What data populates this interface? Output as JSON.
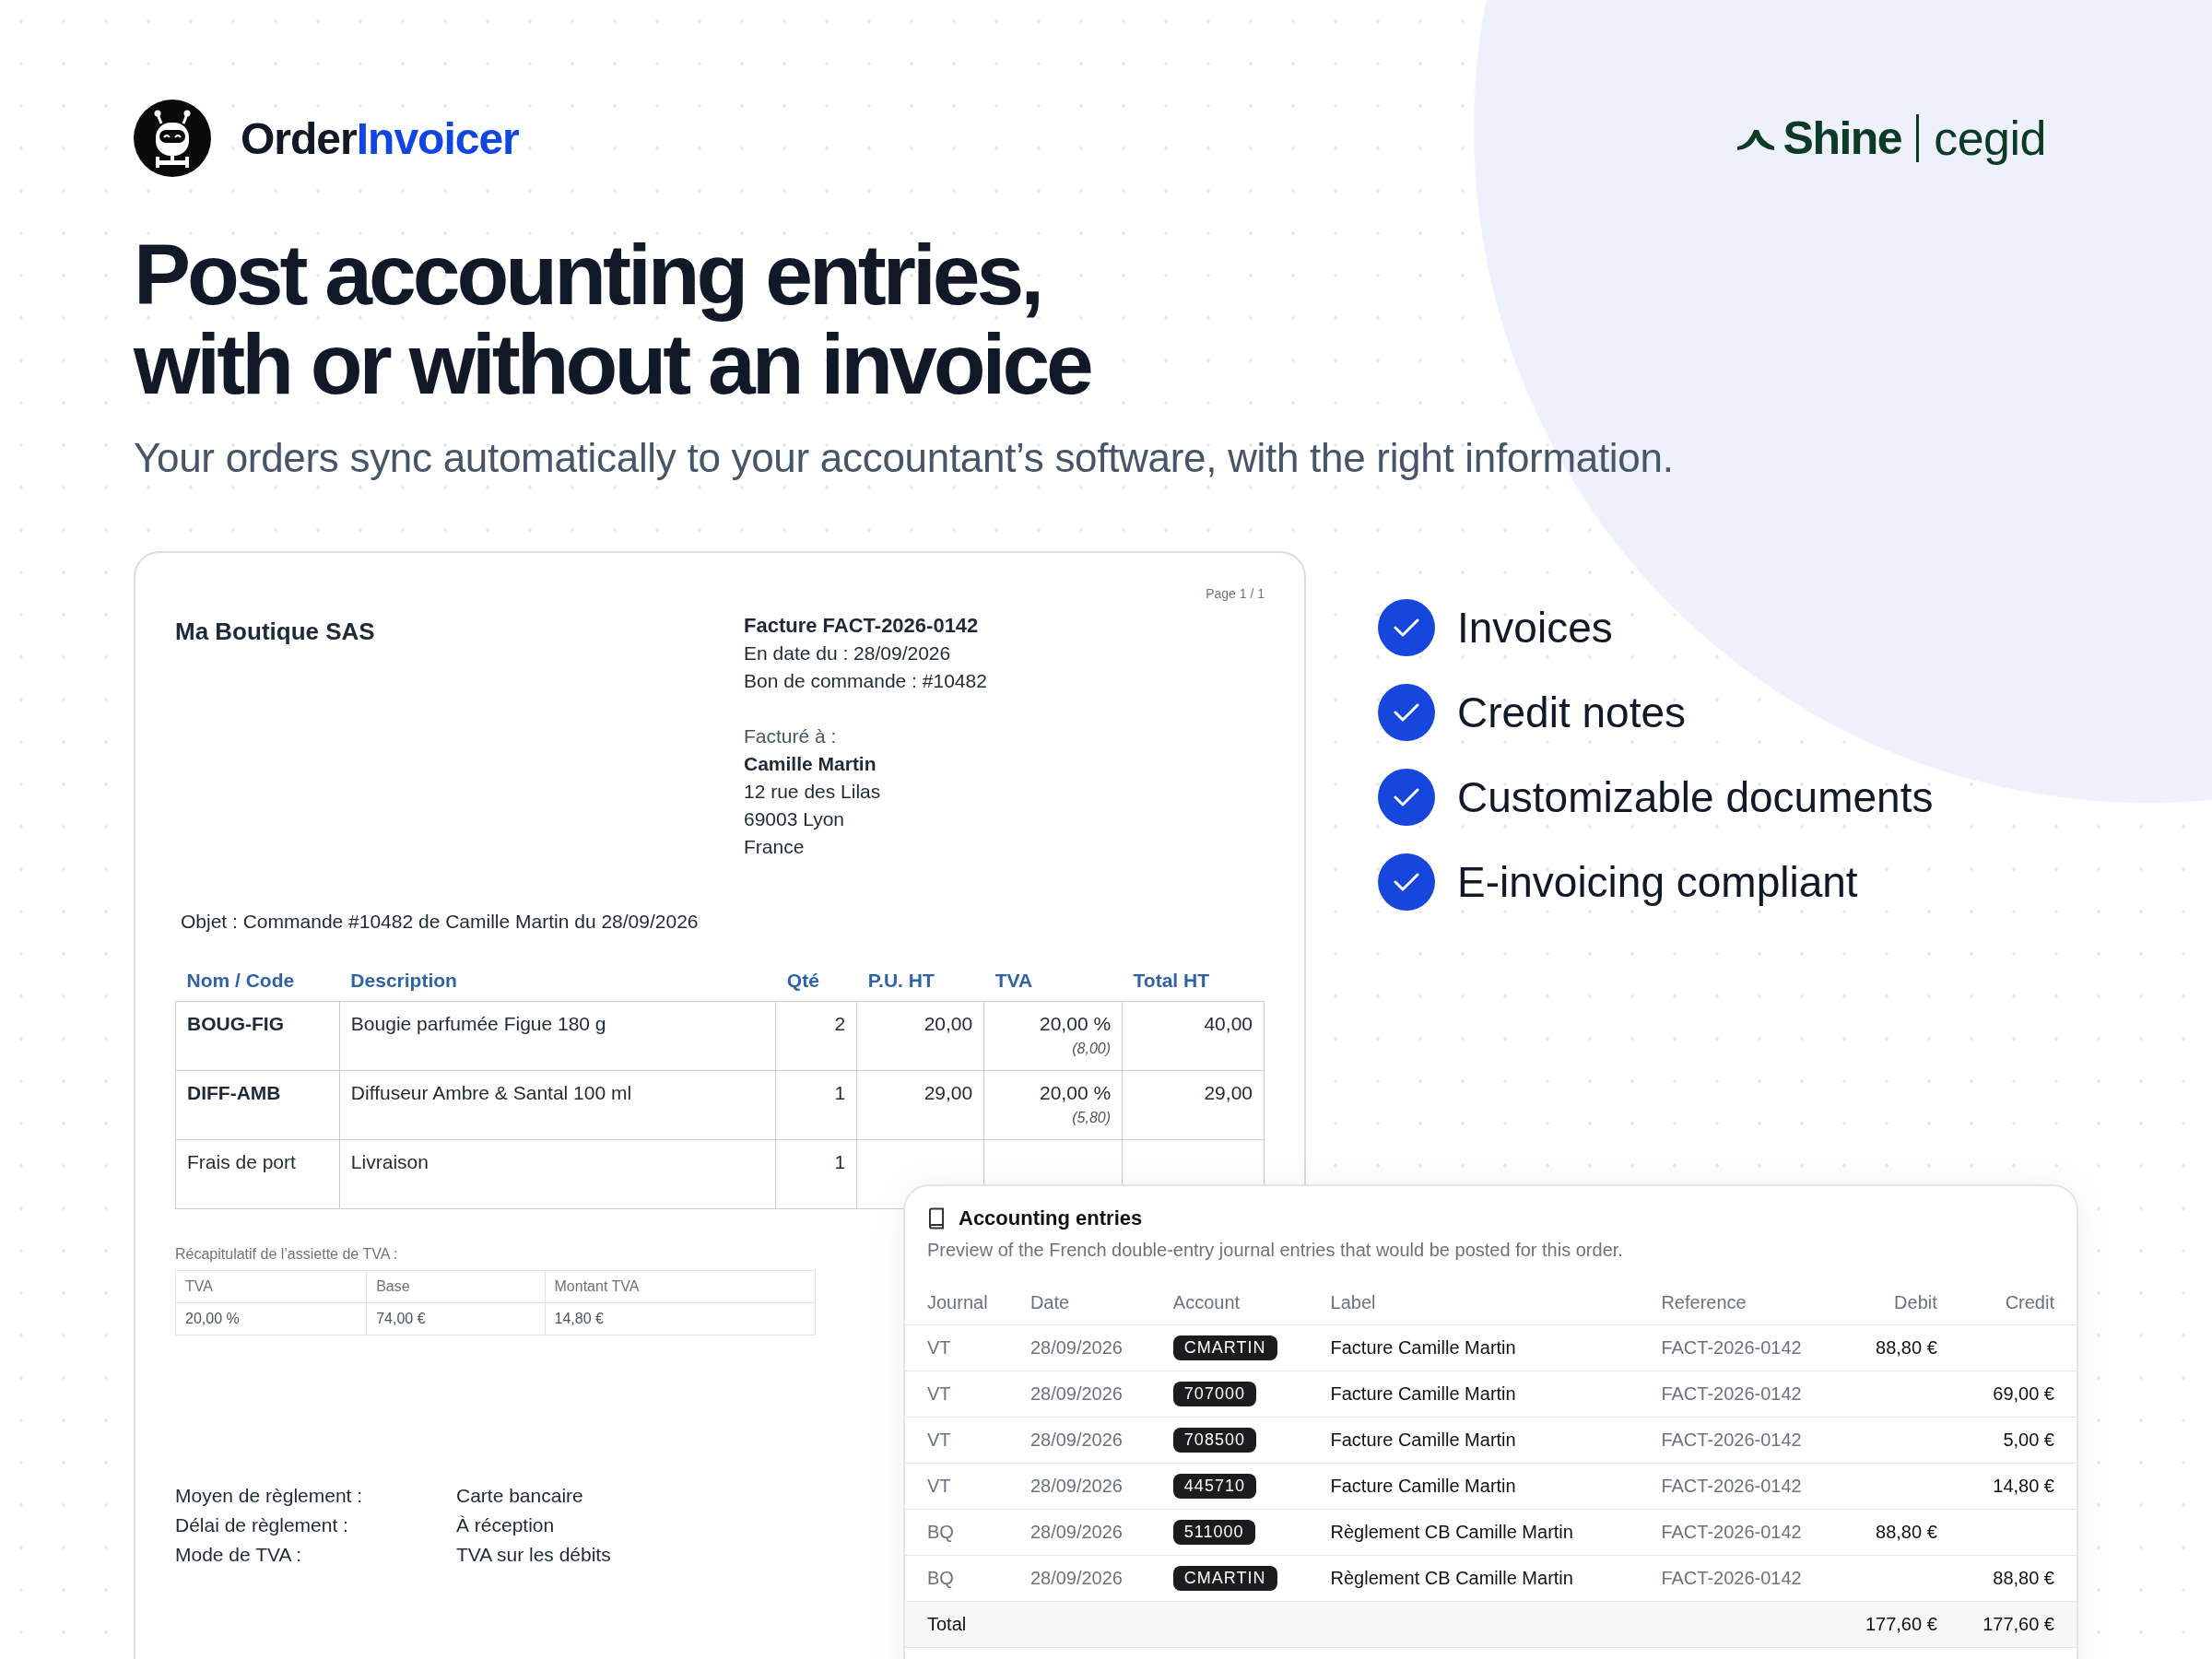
{
  "brand": {
    "name_part_1": "Order",
    "name_part_2": "Invoicer"
  },
  "partners": {
    "first": "Shine",
    "second": "cegid"
  },
  "headline": [
    "Post accounting entries,",
    "with or without an invoice"
  ],
  "subtitle": "Your orders sync automatically to your accountant’s software, with the right information.",
  "invoice": {
    "page": "Page 1 / 1",
    "seller": "Ma Boutique SAS",
    "number": "Facture FACT-2026-0142",
    "date": "En date du : 28/09/2026",
    "order": "Bon de commande : #10482",
    "billed_to_label": "Facturé à :",
    "customer": "Camille Martin",
    "address": [
      "12 rue des Lilas",
      "69003 Lyon",
      "France"
    ],
    "subject": "Objet : Commande #10482 de Camille Martin du 28/09/2026",
    "columns": [
      "Nom / Code",
      "Description",
      "Qté",
      "P.U. HT",
      "TVA",
      "Total HT"
    ],
    "rows": [
      {
        "code": "BOUG-FIG",
        "bold": true,
        "description": "Bougie parfumée Figue 180 g",
        "qty": "2",
        "unit_price": "20,00",
        "tva": "20,00 %",
        "tva_amount": "(8,00)",
        "total": "40,00"
      },
      {
        "code": "DIFF-AMB",
        "bold": true,
        "description": "Diffuseur Ambre & Santal 100 ml",
        "qty": "1",
        "unit_price": "29,00",
        "tva": "20,00 %",
        "tva_amount": "(5,80)",
        "total": "29,00"
      },
      {
        "code": "Frais de port",
        "bold": false,
        "description": "Livraison",
        "qty": "1"
      }
    ],
    "tax_summary_label": "Récapitulatif de l’assiette de TVA :",
    "tax_columns": [
      "TVA",
      "Base",
      "Montant TVA"
    ],
    "tax_rows": [
      [
        "20,00 %",
        "74,00 €",
        "14,80 €"
      ]
    ],
    "payment": [
      {
        "label": "Moyen de règlement :",
        "value": "Carte bancaire"
      },
      {
        "label": "Délai de règlement :",
        "value": "À réception"
      },
      {
        "label": "Mode de TVA :",
        "value": "TVA sur les débits"
      }
    ]
  },
  "features": [
    {
      "label": "Invoices",
      "checked": true
    },
    {
      "label": "Credit notes",
      "checked": true
    },
    {
      "label": "Customizable documents",
      "checked": true
    },
    {
      "label": "E-invoicing compliant",
      "checked": true
    }
  ],
  "accounting": {
    "title": "Accounting entries",
    "description": "Preview of the French double-entry journal entries that would be posted for this order.",
    "columns": [
      "Journal",
      "Date",
      "Account",
      "Label",
      "Reference",
      "Debit",
      "Credit"
    ],
    "rows": [
      {
        "journal": "VT",
        "date": "28/09/2026",
        "account": "CMARTIN",
        "label": "Facture Camille Martin",
        "reference": "FACT-2026-0142",
        "debit": "88,80 €"
      },
      {
        "journal": "VT",
        "date": "28/09/2026",
        "account": "707000",
        "label": "Facture Camille Martin",
        "reference": "FACT-2026-0142",
        "credit": "69,00 €"
      },
      {
        "journal": "VT",
        "date": "28/09/2026",
        "account": "708500",
        "label": "Facture Camille Martin",
        "reference": "FACT-2026-0142",
        "credit": "5,00 €"
      },
      {
        "journal": "VT",
        "date": "28/09/2026",
        "account": "445710",
        "label": "Facture Camille Martin",
        "reference": "FACT-2026-0142",
        "credit": "14,80 €"
      },
      {
        "journal": "BQ",
        "date": "28/09/2026",
        "account": "511000",
        "label": "Règlement CB Camille Martin",
        "reference": "FACT-2026-0142",
        "debit": "88,80 €"
      },
      {
        "journal": "BQ",
        "date": "28/09/2026",
        "account": "CMARTIN",
        "label": "Règlement CB Camille Martin",
        "reference": "FACT-2026-0142",
        "credit": "88,80 €"
      }
    ],
    "total": {
      "label": "Total",
      "debit": "177,60 €",
      "credit": "177,60 €"
    }
  }
}
